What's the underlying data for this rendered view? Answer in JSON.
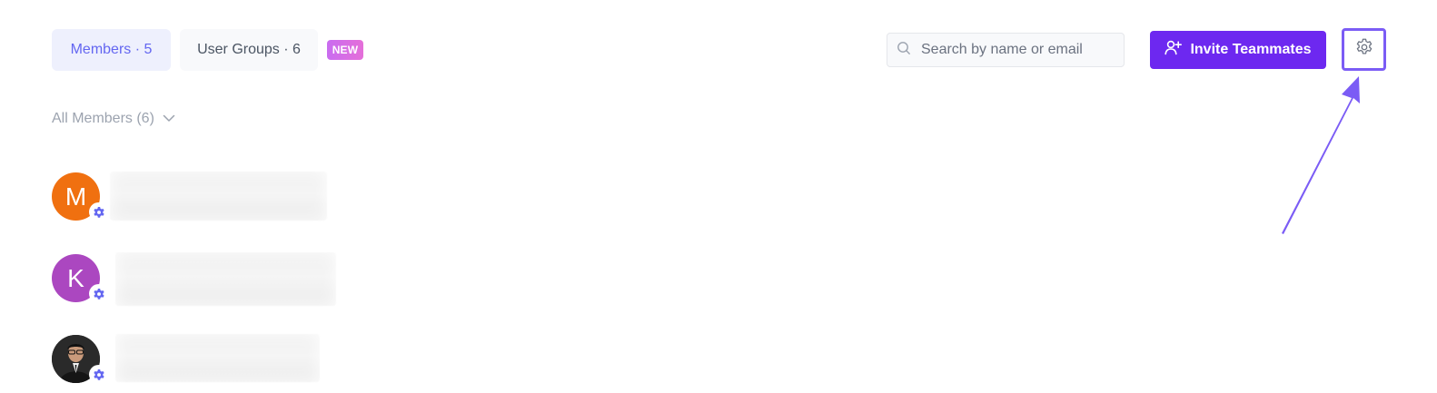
{
  "tabs": {
    "members": "Members · 5",
    "user_groups": "User Groups · 6",
    "new_badge": "NEW"
  },
  "search": {
    "placeholder": "Search by name or email",
    "value": ""
  },
  "actions": {
    "invite_label": "Invite Teammates"
  },
  "filter": {
    "label": "All Members (6)"
  },
  "members": [
    {
      "initial": "M",
      "color": "#f07010"
    },
    {
      "initial": "K",
      "color": "#ab47c0"
    },
    {
      "initial": "",
      "color": "#222222"
    }
  ],
  "colors": {
    "accent": "#6d28f0",
    "tab_active_text": "#6366f1",
    "badge_gear": "#6366f1",
    "annotation": "#7b5cf5"
  },
  "icons": {
    "search": "search-icon",
    "invite": "user-plus-icon",
    "settings": "gear-icon",
    "filter": "chevron-down-icon",
    "member_badge": "gear-icon"
  }
}
